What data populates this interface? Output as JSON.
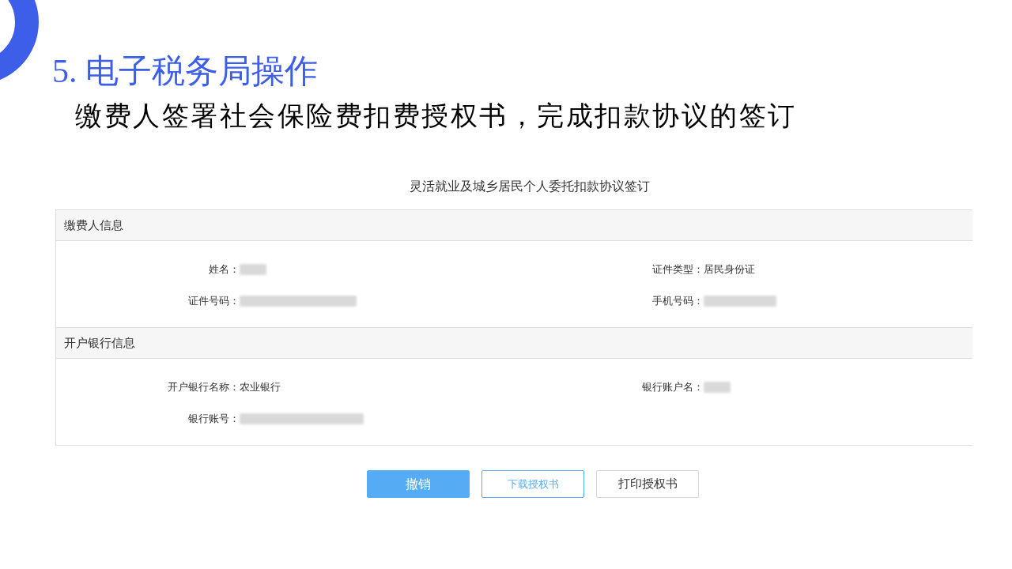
{
  "slide": {
    "heading": "5. 电子税务局操作",
    "subheading": "缴费人签署社会保险费扣费授权书，完成扣款协议的签订"
  },
  "form": {
    "title": "灵活就业及城乡居民个人委托扣款协议签订",
    "sections": [
      {
        "title": "缴费人信息",
        "fields": [
          {
            "label": "姓名：",
            "kind": "redacted"
          },
          {
            "label": "证件类型：",
            "kind": "text",
            "value": "居民身份证"
          },
          {
            "label": "证件号码：",
            "kind": "redacted"
          },
          {
            "label": "手机号码：",
            "kind": "redacted"
          }
        ]
      },
      {
        "title": "开户银行信息",
        "fields": [
          {
            "label": "开户银行名称：",
            "kind": "text",
            "value": "农业银行"
          },
          {
            "label": "银行账户名：",
            "kind": "redacted"
          },
          {
            "label": "银行账号：",
            "kind": "redacted"
          }
        ]
      }
    ]
  },
  "buttons": [
    {
      "label": "撤销",
      "kind": "primary"
    },
    {
      "label": "下载授权书",
      "kind": "outline"
    },
    {
      "label": "打印授权书",
      "kind": "default"
    }
  ]
}
